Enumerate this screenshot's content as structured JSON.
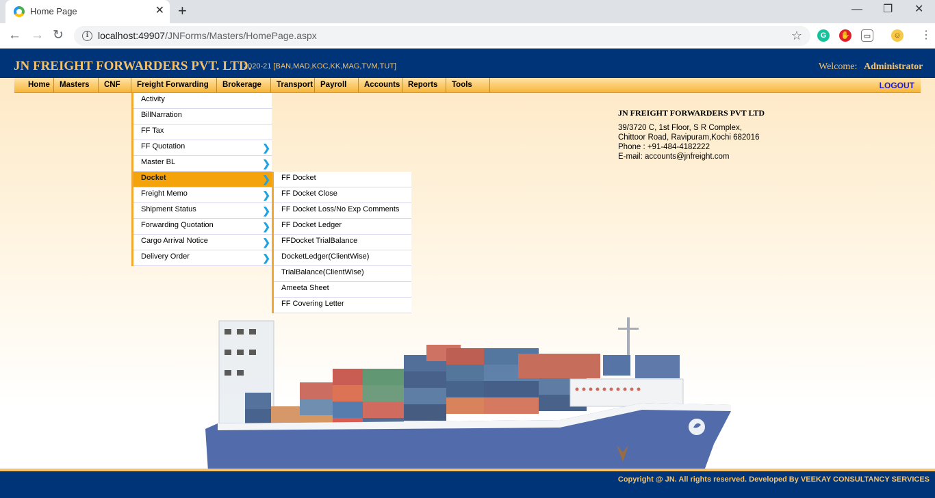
{
  "browser": {
    "tab_title": "Home Page",
    "new_tab": "+",
    "url_host": "localhost:49907",
    "url_path": "/JNForms/Masters/HomePage.aspx"
  },
  "header": {
    "company": "JN FREIGHT FORWARDERS PVT. LTD.",
    "fy": "2020-21 [BAN,MAD,KOC,KK,MAG,TVM,TUT]",
    "welcome_label": "Welcome:",
    "username": "Administrator"
  },
  "menu": {
    "items": [
      "Home",
      "Masters",
      "CNF",
      "Freight Forwarding",
      "Brokerage",
      "Transport",
      "Payroll",
      "Accounts",
      "Reports",
      "Tools"
    ],
    "logout": "LOGOUT"
  },
  "dropdown": {
    "items": [
      {
        "label": "Activity",
        "has_sub": false
      },
      {
        "label": "BillNarration",
        "has_sub": false
      },
      {
        "label": "FF Tax",
        "has_sub": false
      },
      {
        "label": "FF Quotation",
        "has_sub": true
      },
      {
        "label": "Master BL",
        "has_sub": true
      },
      {
        "label": "Docket",
        "has_sub": true,
        "active": true
      },
      {
        "label": "Freight Memo",
        "has_sub": true
      },
      {
        "label": "Shipment Status",
        "has_sub": true
      },
      {
        "label": "Forwarding Quotation",
        "has_sub": true
      },
      {
        "label": "Cargo Arrival Notice",
        "has_sub": true
      },
      {
        "label": "Delivery Order",
        "has_sub": true
      }
    ],
    "arrow": "❯"
  },
  "submenu": {
    "items": [
      "FF Docket",
      "FF Docket Close",
      "FF Docket Loss/No Exp Comments",
      "FF Docket Ledger",
      "FFDocket TrialBalance",
      "DocketLedger(ClientWise)",
      "TrialBalance(ClientWise)",
      "Ameeta Sheet",
      "FF Covering Letter"
    ]
  },
  "address": {
    "title": "JN FREIGHT FORWARDERS PVT LTD",
    "line1": "39/3720 C, 1st Floor, S R Complex,",
    "line2": "Chittoor Road, Ravipuram,Kochi 682016",
    "line3": "Phone : +91-484-4182222",
    "line4": "E-mail: accounts@jnfreight.com"
  },
  "footer": {
    "copyright": "Copyright @ JN. All rights reserved. Developed By VEEKAY CONSULTANCY SERVICES"
  },
  "colors": {
    "header_bg": "#003478",
    "gold": "#f5c26b",
    "menu_active": "#f5a30a",
    "arrow": "#1fa3e0"
  }
}
